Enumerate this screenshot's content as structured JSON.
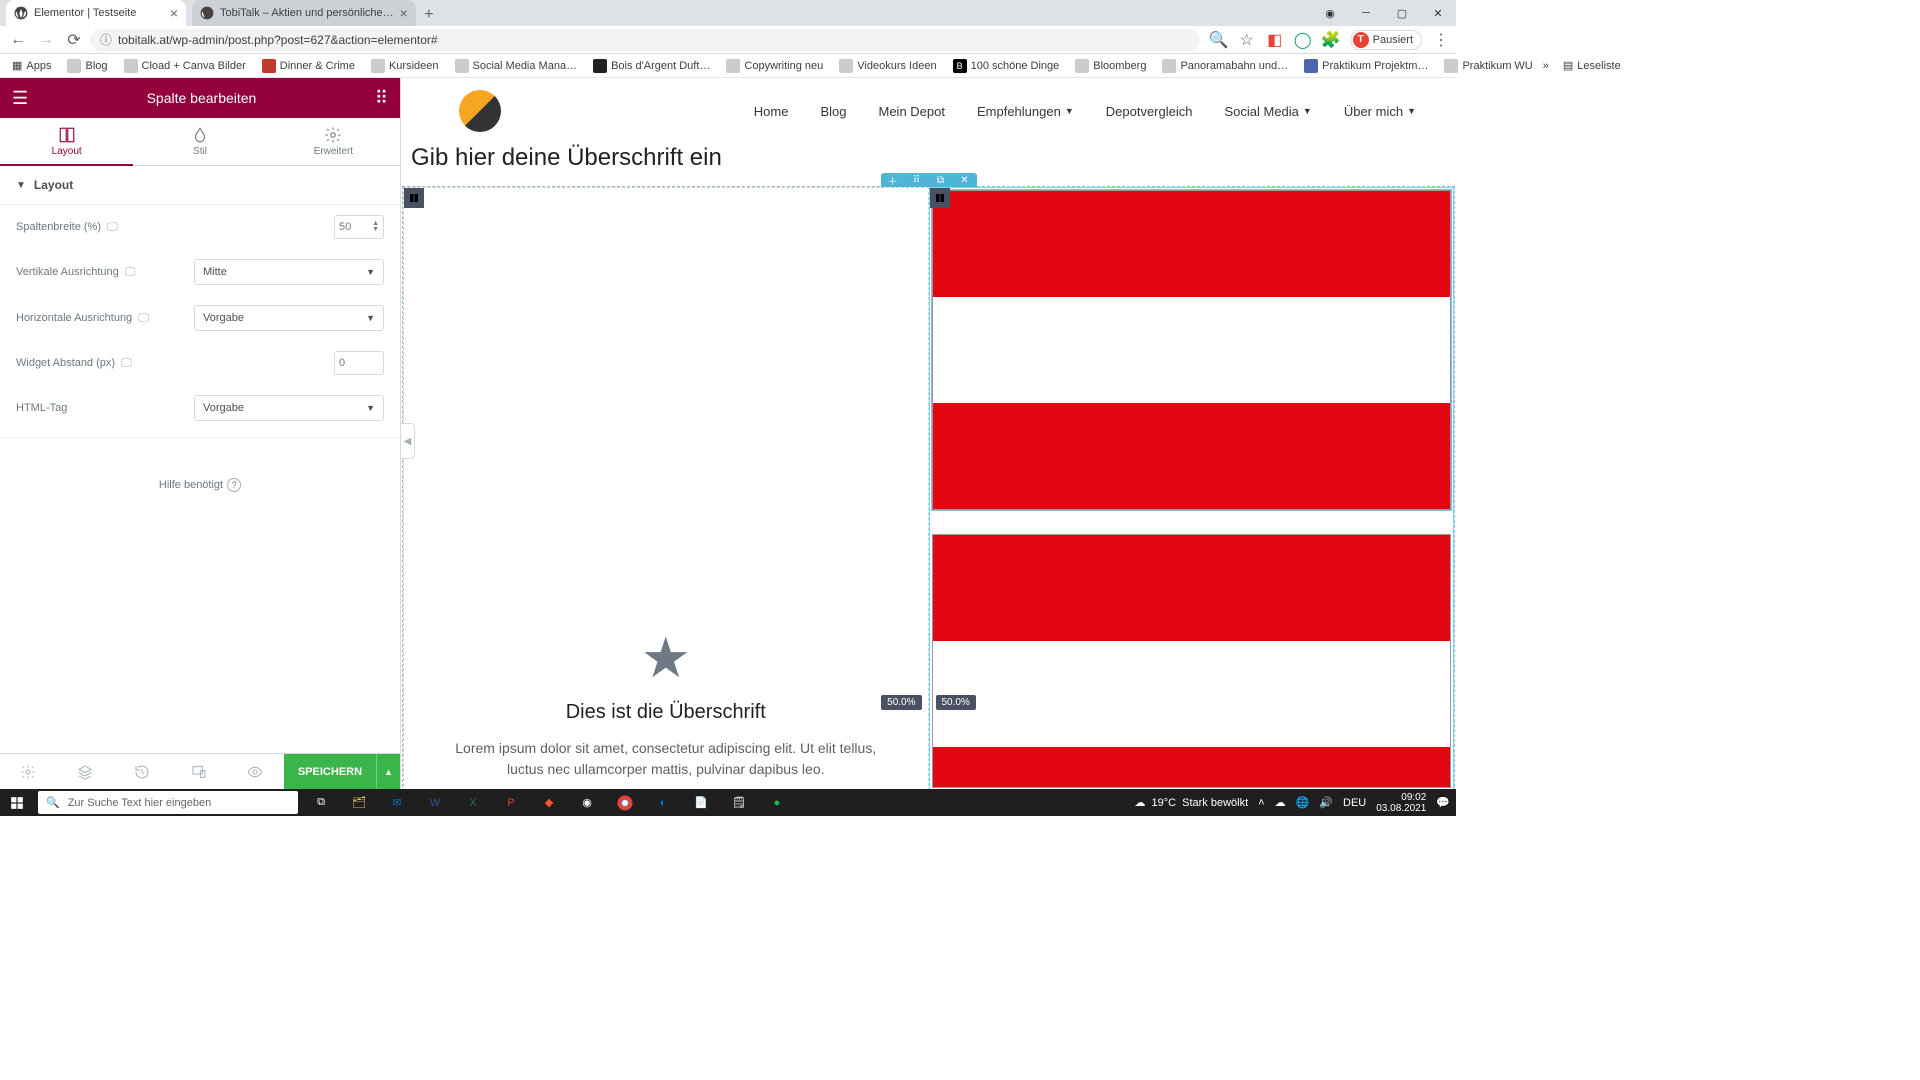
{
  "browser": {
    "tabs": [
      {
        "title": "Elementor | Testseite"
      },
      {
        "title": "TobiTalk – Aktien und persönliche…"
      }
    ],
    "url": "tobitalk.at/wp-admin/post.php?post=627&action=elementor#",
    "profile_label": "Pausiert",
    "profile_initial": "T",
    "bookmarks": [
      "Apps",
      "Blog",
      "Cload + Canva Bilder",
      "Dinner & Crime",
      "Kursideen",
      "Social Media Mana…",
      "Bois d'Argent Duft…",
      "Copywriting neu",
      "Videokurs Ideen",
      "100 schöne Dinge",
      "Bloomberg",
      "Panoramabahn und…",
      "Praktikum Projektm…",
      "Praktikum WU"
    ],
    "more_bookmarks": "»",
    "reading_list": "Leseliste"
  },
  "panel": {
    "title": "Spalte bearbeiten",
    "tabs": {
      "layout": "Layout",
      "style": "Stil",
      "advanced": "Erweitert"
    },
    "section": "Layout",
    "rows": {
      "colwidth_label": "Spaltenbreite (%)",
      "colwidth_value": "50",
      "valign_label": "Vertikale Ausrichtung",
      "valign_value": "Mitte",
      "halign_label": "Horizontale Ausrichtung",
      "halign_value": "Vorgabe",
      "gap_label": "Widget Abstand (px)",
      "gap_value": "0",
      "htmltag_label": "HTML-Tag",
      "htmltag_value": "Vorgabe"
    },
    "help": "Hilfe benötigt",
    "save": "SPEICHERN"
  },
  "preview": {
    "nav": [
      "Home",
      "Blog",
      "Mein Depot",
      "Empfehlungen",
      "Depotvergleich",
      "Social Media",
      "Über mich"
    ],
    "page_title": "Gib hier deine Überschrift ein",
    "iconbox_title": "Dies ist die Überschrift",
    "iconbox_text": "Lorem ipsum dolor sit amet, consectetur adipiscing elit. Ut elit tellus, luctus nec ullamcorper mattis, pulvinar dapibus leo.",
    "size_left": "50.0%",
    "size_right": "50.0%"
  },
  "taskbar": {
    "search_placeholder": "Zur Suche Text hier eingeben",
    "weather_temp": "19°C",
    "weather_text": "Stark bewölkt",
    "time": "09:02",
    "date": "03.08.2021",
    "lang": "DEU"
  }
}
